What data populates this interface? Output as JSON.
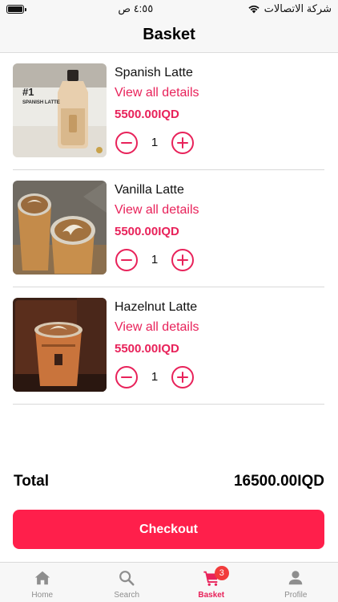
{
  "status_bar": {
    "time": "٤:٥٥ ص",
    "carrier": "شركة الاتصالات"
  },
  "header": {
    "title": "Basket"
  },
  "items": [
    {
      "name": "Spanish Latte",
      "details_link": "View all details",
      "price": "5500.00IQD",
      "quantity": "1",
      "thumb_label": "#1",
      "thumb_sublabel": "SPANISH LATTE"
    },
    {
      "name": "Vanilla Latte",
      "details_link": "View all details",
      "price": "5500.00IQD",
      "quantity": "1"
    },
    {
      "name": "Hazelnut Latte",
      "details_link": "View all details",
      "price": "5500.00IQD",
      "quantity": "1"
    }
  ],
  "summary": {
    "total_label": "Total",
    "total_value": "16500.00IQD"
  },
  "checkout_label": "Checkout",
  "tabs": [
    {
      "label": "Home",
      "icon": "home-icon"
    },
    {
      "label": "Search",
      "icon": "search-icon"
    },
    {
      "label": "Basket",
      "icon": "cart-icon",
      "badge": "3",
      "active": true
    },
    {
      "label": "Profile",
      "icon": "profile-icon"
    }
  ],
  "colors": {
    "accent": "#e8225a",
    "checkout": "#ff1f4b",
    "badge": "#f23b3b",
    "inactive_tab": "#8e8e8e"
  }
}
